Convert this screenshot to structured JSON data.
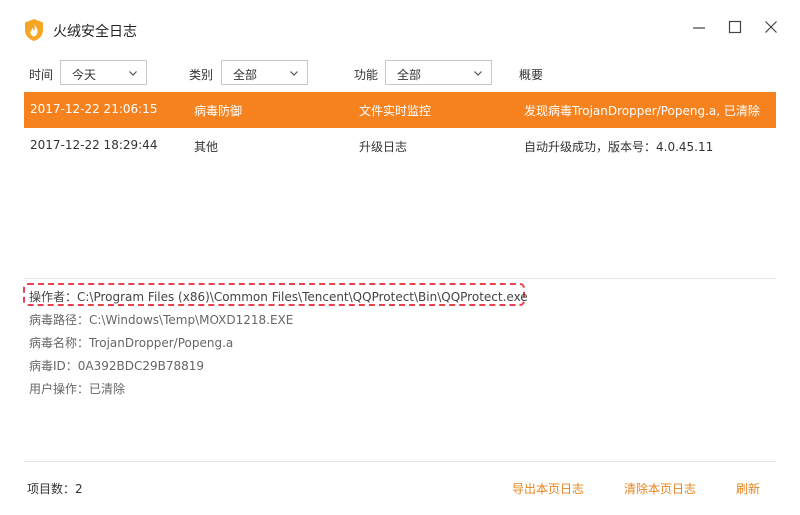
{
  "window": {
    "title": "火绒安全日志"
  },
  "filters": {
    "time_label": "时间",
    "time_value": "今天",
    "category_label": "类别",
    "category_value": "全部",
    "function_label": "功能",
    "function_value": "全部",
    "summary_header": "概要"
  },
  "log_rows": [
    {
      "time": "2017-12-22 21:06:15",
      "category": "病毒防御",
      "function": "文件实时监控",
      "summary": "发现病毒TrojanDropper/Popeng.a, 已清除",
      "selected": true
    },
    {
      "time": "2017-12-22 18:29:44",
      "category": "其他",
      "function": "升级日志",
      "summary": "自动升级成功，版本号：4.0.45.11",
      "selected": false
    }
  ],
  "details": {
    "operator": "操作者：C:\\Program Files (x86)\\Common Files\\Tencent\\QQProtect\\Bin\\QQProtect.exe",
    "virus_path": "病毒路径：C:\\Windows\\Temp\\MOXD1218.EXE",
    "virus_name": "病毒名称：TrojanDropper/Popeng.a",
    "virus_id": "病毒ID：0A392BDC29B78819",
    "user_action": "用户操作：已清除"
  },
  "footer": {
    "item_count": "项目数：2",
    "export_label": "导出本页日志",
    "clear_label": "清除本页日志",
    "refresh_label": "刷新"
  },
  "colors": {
    "accent": "#f5821f",
    "link": "#e8841f",
    "highlight_border": "#e8424f"
  },
  "icons": {
    "logo": "fire-shield-icon",
    "minimize": "minimize-icon",
    "maximize": "maximize-icon",
    "close": "close-icon",
    "dropdown": "chevron-down-icon"
  }
}
